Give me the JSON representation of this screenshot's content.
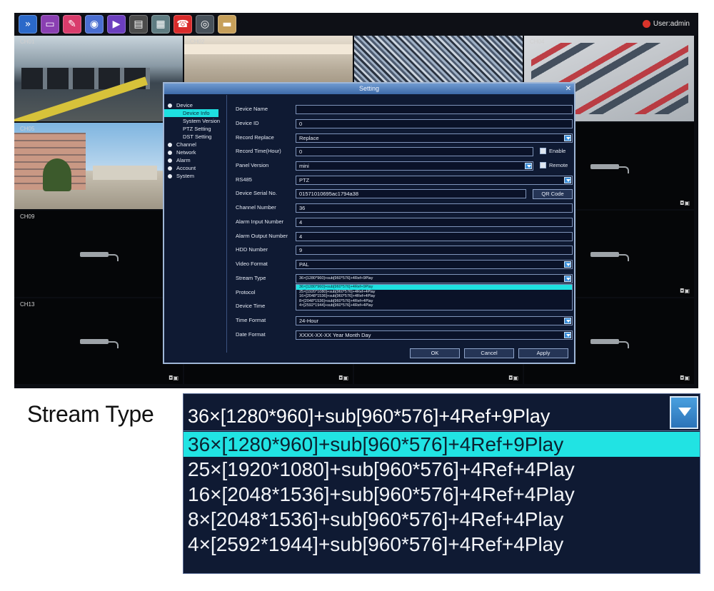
{
  "dvr": {
    "user_label": "User:admin",
    "toolbar_icons": [
      {
        "icon": "arrow-icon",
        "color": "#2b69c9",
        "glyph": "»"
      },
      {
        "icon": "tv-icon",
        "color": "#8a3fb2",
        "glyph": "▭"
      },
      {
        "icon": "config-icon",
        "color": "#d93c6c",
        "glyph": "✎"
      },
      {
        "icon": "disk-icon",
        "color": "#4a6ed1",
        "glyph": "◉"
      },
      {
        "icon": "play-icon",
        "color": "#6c3fbf",
        "glyph": "▶"
      },
      {
        "icon": "backup-icon",
        "color": "#4b4b4b",
        "glyph": "▤"
      },
      {
        "icon": "storage-icon",
        "color": "#5f7c82",
        "glyph": "▦"
      },
      {
        "icon": "alarm-icon",
        "color": "#d92b2b",
        "glyph": "☎"
      },
      {
        "icon": "camera-icon",
        "color": "#47515a",
        "glyph": "◎"
      },
      {
        "icon": "folder-icon",
        "color": "#c7a05a",
        "glyph": "▬"
      }
    ],
    "channels": [
      "CH01",
      "CH02",
      "",
      "CH04",
      "CH05",
      "",
      "",
      "",
      "CH09",
      "",
      "",
      "",
      "CH13",
      "",
      "",
      ""
    ]
  },
  "dialog": {
    "title": "Setting",
    "close": "✕",
    "tree": [
      {
        "label": "Device",
        "level": "top"
      },
      {
        "label": "Device Info",
        "level": "sub",
        "selected": true
      },
      {
        "label": "System Version",
        "level": "sub"
      },
      {
        "label": "PTZ Setting",
        "level": "sub"
      },
      {
        "label": "DST Setting",
        "level": "sub"
      },
      {
        "label": "Channel",
        "level": "top"
      },
      {
        "label": "Network",
        "level": "top"
      },
      {
        "label": "Alarm",
        "level": "top"
      },
      {
        "label": "Account",
        "level": "top"
      },
      {
        "label": "System",
        "level": "top"
      }
    ],
    "fields": {
      "device_name": {
        "label": "Device Name",
        "value": ""
      },
      "device_id": {
        "label": "Device ID",
        "value": "0"
      },
      "record_replace": {
        "label": "Record Replace",
        "value": "Replace"
      },
      "record_time": {
        "label": "Record Time(Hour)",
        "value": "0",
        "check": "Enable"
      },
      "panel_version": {
        "label": "Panel Version",
        "value": "mini",
        "check": "Remote"
      },
      "rs485": {
        "label": "RS485",
        "value": "PTZ"
      },
      "serial": {
        "label": "Device Serial No.",
        "value": "01571010695ac1794a38",
        "button": "QR Code"
      },
      "channel_number": {
        "label": "Channel Number",
        "value": "36"
      },
      "alarm_input": {
        "label": "Alarm Input Number",
        "value": "4"
      },
      "alarm_output": {
        "label": "Alarm Output Number",
        "value": "4"
      },
      "hdd_number": {
        "label": "HDD Number",
        "value": "9"
      },
      "video_format": {
        "label": "Video Format",
        "value": "PAL"
      },
      "stream_type": {
        "label": "Stream Type",
        "value": "36×[1280*960]+sub[960*576]+4Ref+9Play"
      },
      "protocol": {
        "label": "Protocol"
      },
      "device_time": {
        "label": "Device Time"
      },
      "time_format": {
        "label": "Time Format",
        "value": "24-Hour"
      },
      "date_format": {
        "label": "Date Format",
        "value": "XXXX-XX-XX Year Month Day"
      }
    },
    "buttons": {
      "ok": "OK",
      "cancel": "Cancel",
      "apply": "Apply"
    }
  },
  "callout": {
    "label": "Stream Type",
    "current": "36×[1280*960]+sub[960*576]+4Ref+9Play",
    "options": [
      "36×[1280*960]+sub[960*576]+4Ref+9Play",
      "25×[1920*1080]+sub[960*576]+4Ref+4Play",
      "16×[2048*1536]+sub[960*576]+4Ref+4Play",
      "8×[2048*1536]+sub[960*576]+4Ref+4Play",
      "4×[2592*1944]+sub[960*576]+4Ref+4Play"
    ]
  },
  "colors": {
    "highlight": "#21e3e3",
    "panel": "#0f1a33"
  }
}
